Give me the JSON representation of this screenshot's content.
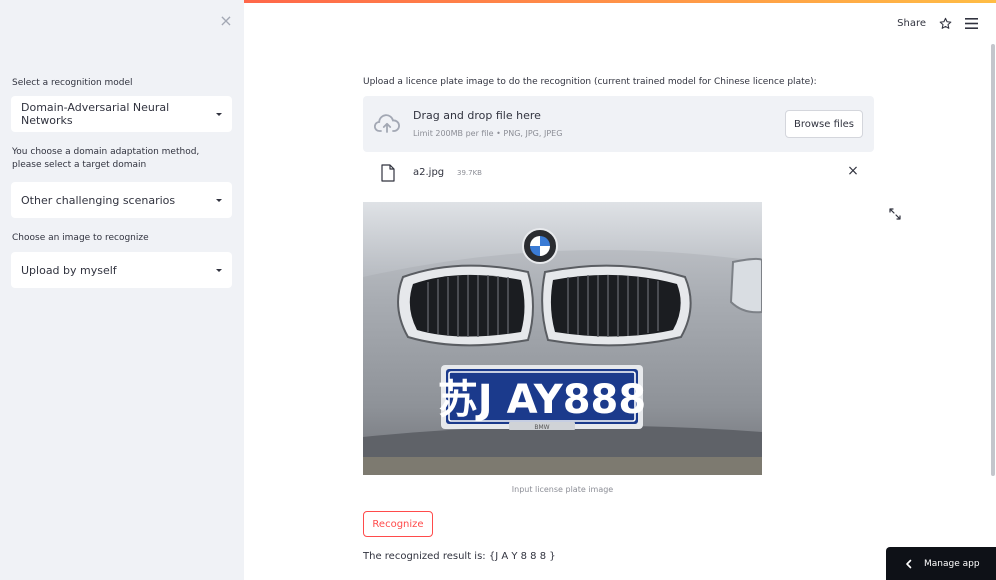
{
  "sidebar": {
    "close_glyph": "×",
    "model_label": "Select a recognition model",
    "model_value": "Domain-Adversarial Neural Networks",
    "domain_label": "You choose a domain adaptation method, please select a target domain",
    "domain_value": "Other challenging scenarios",
    "image_label": "Choose an image to recognize",
    "image_value": "Upload by myself"
  },
  "header": {
    "share_label": "Share",
    "star_icon": "star-icon",
    "menu_icon": "hamburger-menu-icon"
  },
  "upload": {
    "label": "Upload a licence plate image to do the recognition (current trained model for Chinese licence plate):",
    "drop_title": "Drag and drop file here",
    "drop_subtitle": "Limit 200MB per file • PNG, JPG, JPEG",
    "browse_label": "Browse files",
    "cloud_icon": "cloud-upload-icon"
  },
  "file": {
    "name": "a2.jpg",
    "size": "39.7KB",
    "remove_glyph": "×"
  },
  "image": {
    "plate_text": "苏J AY888",
    "plate_badge": "BMW",
    "caption": "Input license plate image"
  },
  "actions": {
    "recognize_label": "Recognize",
    "result_text": "The recognized result is: {J A Y 8 8 8 }"
  },
  "manage_app": {
    "label": "Manage app"
  },
  "colors": {
    "accent": "#ff4b4b",
    "sidebar_bg": "#f0f2f6",
    "text": "#31333f",
    "muted": "#8c8e96",
    "plate_blue": "#1b3a8c"
  }
}
